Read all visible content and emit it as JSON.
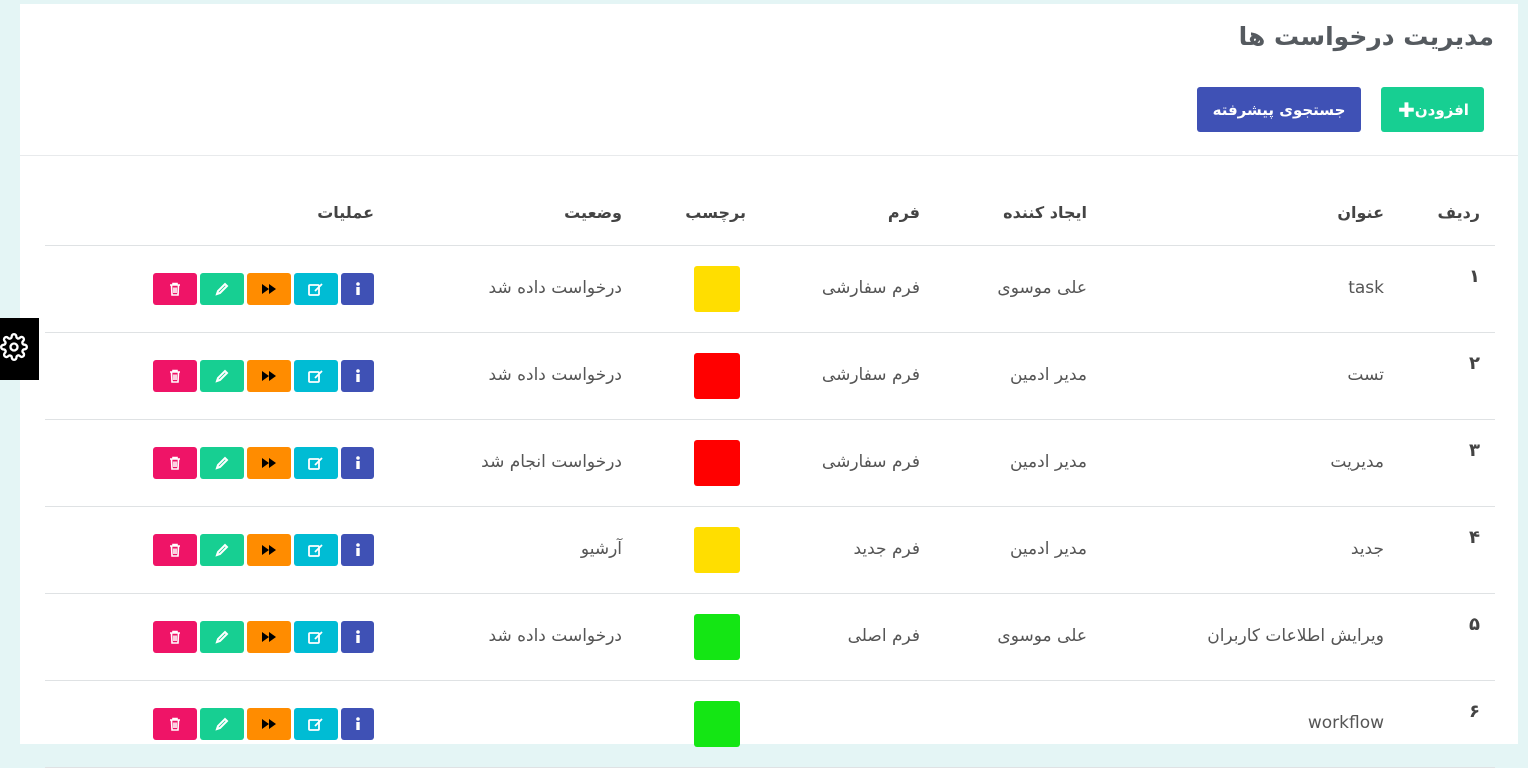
{
  "page": {
    "title": "مدیریت درخواست ها"
  },
  "toolbar": {
    "add_label": "افزودن",
    "add_icon": "plus-icon",
    "search_label": "جستجوی پیشرفته"
  },
  "table": {
    "headers": {
      "index": "ردیف",
      "title": "عنوان",
      "creator": "ایجاد کننده",
      "form": "فرم",
      "tag": "برچسب",
      "status": "وضعیت",
      "actions": "عملیات"
    },
    "rows": [
      {
        "index": "۱",
        "title": "task",
        "creator": "علی موسوی",
        "form": "فرم سفارشی",
        "tag_color": "#ffde00",
        "status": "درخواست داده شد"
      },
      {
        "index": "۲",
        "title": "تست",
        "creator": "مدیر ادمین",
        "form": "فرم سفارشی",
        "tag_color": "#ff0000",
        "status": "درخواست داده شد"
      },
      {
        "index": "۳",
        "title": "مدیریت",
        "creator": "مدیر ادمین",
        "form": "فرم سفارشی",
        "tag_color": "#ff0000",
        "status": "درخواست انجام شد"
      },
      {
        "index": "۴",
        "title": "جدید",
        "creator": "مدیر ادمین",
        "form": "فرم جدید",
        "tag_color": "#ffde00",
        "status": "آرشیو"
      },
      {
        "index": "۵",
        "title": "ویرایش اطلاعات کاربران",
        "creator": "علی موسوی",
        "form": "فرم اصلی",
        "tag_color": "#14e614",
        "status": "درخواست داده شد"
      },
      {
        "index": "۶",
        "title": "workflow",
        "creator": "",
        "form": "",
        "tag_color": "#14e614",
        "status": ""
      }
    ],
    "action_icons": [
      "info-icon",
      "edit-icon",
      "fast-forward-icon",
      "pencil-icon",
      "trash-icon"
    ]
  },
  "colors": {
    "add_button": "#17cf92",
    "search_button": "#3f51b5",
    "info": "#3f51b5",
    "edit": "#00bcd4",
    "forward": "#ff8c00",
    "pencil": "#17cf92",
    "delete": "#ef1467"
  },
  "side": {
    "settings_icon": "gear-icon"
  }
}
